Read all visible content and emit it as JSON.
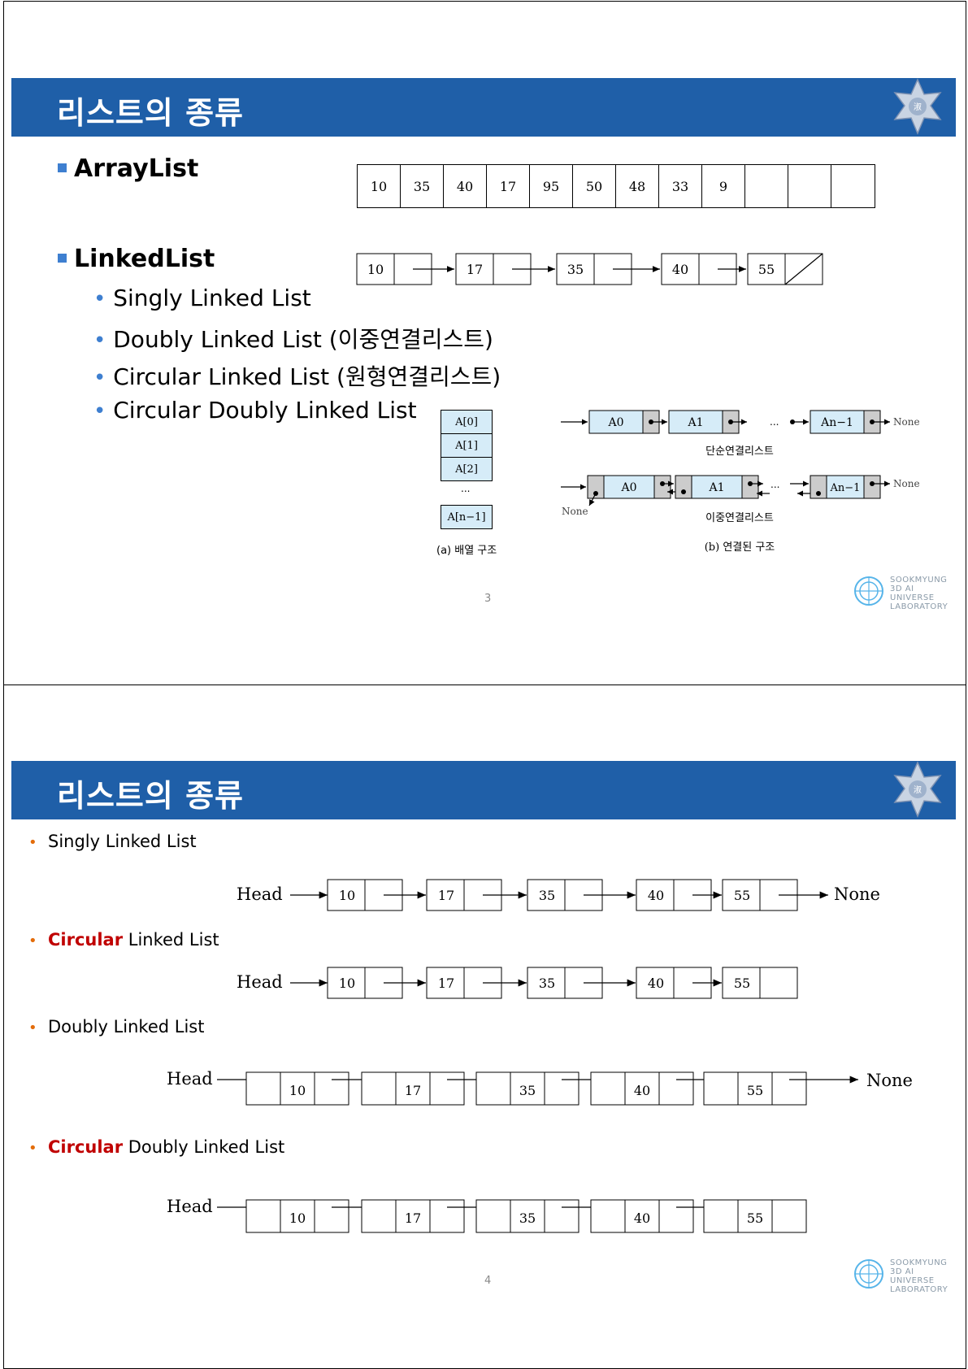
{
  "slide1": {
    "title": "리스트의 종류",
    "arraylist_label": "ArrayList",
    "array_values": [
      "10",
      "35",
      "40",
      "17",
      "95",
      "50",
      "48",
      "33",
      "9",
      "",
      "",
      ""
    ],
    "linkedlist_label": "LinkedList",
    "linked_values": [
      "10",
      "17",
      "35",
      "40",
      "55"
    ],
    "sub_items": [
      "Singly Linked List",
      "Doubly Linked List (이중연결리스트)",
      "Circular Linked List (원형연결리스트)",
      "Circular Doubly Linked List"
    ],
    "figure": {
      "array_cells": [
        "A[0]",
        "A[1]",
        "A[2]",
        "...",
        "A[n−1]"
      ],
      "array_caption": "(a) 배열 구조",
      "node_a0": "A0",
      "node_a1": "A1",
      "node_an": "An−1",
      "ellipsis": "...",
      "none_label": "None",
      "singly_caption": "단순연결리스트",
      "doubly_caption": "이중연결리스트",
      "linked_caption": "(b) 연결된 구조"
    },
    "page_number": "3"
  },
  "slide2": {
    "title": "리스트의 종류",
    "sections": [
      {
        "pre": "",
        "highlight": "",
        "label": "Singly Linked List"
      },
      {
        "pre": "",
        "highlight": "Circular",
        "label": " Linked List"
      },
      {
        "pre": "",
        "highlight": "",
        "label": "Doubly Linked List"
      },
      {
        "pre": "",
        "highlight": "Circular",
        "label": " Doubly Linked List"
      }
    ],
    "head_label": "Head",
    "none_label": "None",
    "values": [
      "10",
      "17",
      "35",
      "40",
      "55"
    ],
    "page_number": "4"
  },
  "lab_logo": {
    "line1": "SOOKMYUNG",
    "line2": "3D AI UNIVERSE",
    "line3": "LABORATORY"
  },
  "colors": {
    "title_bar": "#1f5fa8",
    "bullet_blue": "#3e7fd0",
    "bullet_orange": "#e36c0a",
    "highlight_red": "#c00000",
    "node_fill": "#d6ecf8"
  }
}
